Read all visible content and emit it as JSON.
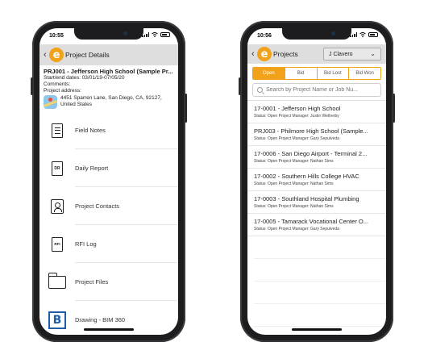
{
  "left": {
    "status": {
      "time": "10:55"
    },
    "header": {
      "back": "‹",
      "logo": "e",
      "title": "Project Details"
    },
    "project": {
      "title": "PRJ001 - Jefferson High School (Sample Pr...",
      "dates": "Start/end dates:  03/01/19-07/05/20",
      "comments": "Comments:",
      "address_label": "Project address:",
      "address_line1": "4451 Sparren Lane, San Diego, CA, 92127,",
      "address_line2": "United States"
    },
    "menu": [
      {
        "label": "Field Notes",
        "icon": "document-lines-icon"
      },
      {
        "label": "Daily Report",
        "icon": "dr-document-icon",
        "badge": "DR"
      },
      {
        "label": "Project Contacts",
        "icon": "contact-card-icon"
      },
      {
        "label": "RFI Log",
        "icon": "rfi-document-icon",
        "badge": "RFI"
      },
      {
        "label": "Project Files",
        "icon": "folder-icon"
      },
      {
        "label": "Drawing - BIM 360",
        "icon": "bim360-icon",
        "badge": "B"
      }
    ]
  },
  "right": {
    "status": {
      "time": "10:56"
    },
    "header": {
      "back": "‹",
      "logo": "e",
      "title": "Projects",
      "user": "J Clavero",
      "chevron": "⌄"
    },
    "tabs": [
      {
        "label": "Open",
        "active": true
      },
      {
        "label": "Bid",
        "active": false
      },
      {
        "label": "Bid Lost",
        "active": false
      },
      {
        "label": "Bid Won",
        "active": false
      }
    ],
    "search": {
      "placeholder": "Search by Project Name or Job Nu..."
    },
    "projects": [
      {
        "title": "17-0001 - Jefferson High School",
        "status": "Status: Open Project Manager: Justin Wetherby"
      },
      {
        "title": "PRJ003 - Philmore High School (Sample...",
        "status": "Status: Open Project Manager: Gary Sepulveda"
      },
      {
        "title": "17-0006 - San Diego Airport - Terminal 2...",
        "status": "Status: Open Project Manager: Nathan Sims"
      },
      {
        "title": "17-0002 - Southern Hills College HVAC",
        "status": "Status: Open Project Manager: Nathan Sims"
      },
      {
        "title": "17-0003 - Southland Hospital Plumbing",
        "status": "Status: Open Project Manager: Nathan Sims"
      },
      {
        "title": "17-0005 - Tamarack Vocational Center O...",
        "status": "Status: Open Project Manager: Gary Sepulveda"
      }
    ]
  },
  "colors": {
    "accent": "#f2a21a",
    "header_bg": "#dedede",
    "bim_blue": "#1f5fa8"
  }
}
